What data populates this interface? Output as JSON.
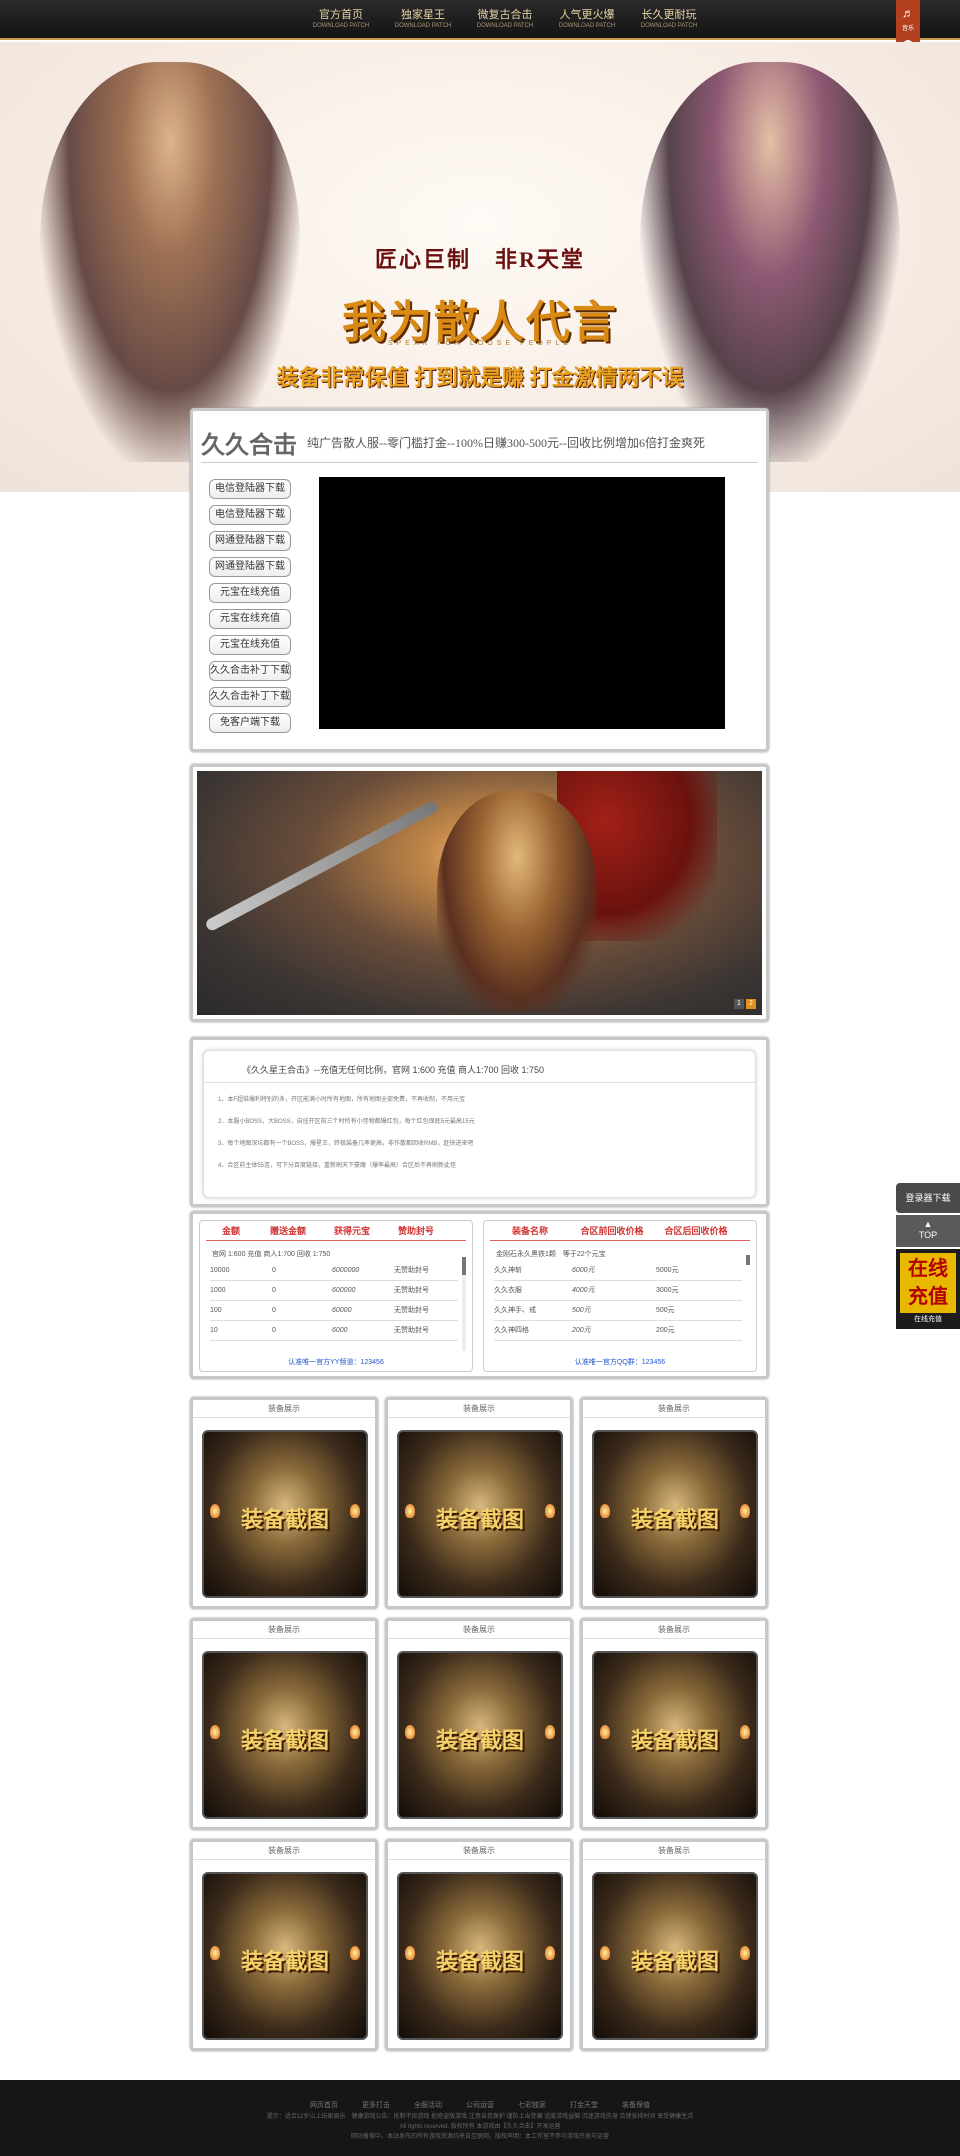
{
  "nav": {
    "items": [
      {
        "title": "官方首页",
        "sub": "DOWNLOAD PATCH"
      },
      {
        "title": "独家星王",
        "sub": "DOWNLOAD PATCH"
      },
      {
        "title": "微复古合击",
        "sub": "DOWNLOAD PATCH"
      },
      {
        "title": "人气更火爆",
        "sub": "DOWNLOAD PATCH"
      },
      {
        "title": "长久更耐玩",
        "sub": "DOWNLOAD PATCH"
      }
    ],
    "music_label": "音乐"
  },
  "hero": {
    "line1": "匠心巨制　非R天堂",
    "line2": "我为散人代言",
    "line2_sub": "SPEAK FOR LOOSE PEOPLE",
    "line3": "装备非常保值 打到就是赚 打金激情两不误"
  },
  "intro": {
    "brand": "久久合击",
    "slogan": "纯广告散人服--零门槛打金--100%日赚300-500元--回收比例增加6倍打金爽死",
    "downloads": [
      "电信登陆器下载",
      "电信登陆器下载",
      "网通登陆器下载",
      "网通登陆器下载",
      "元宝在线充值",
      "元宝在线充值",
      "元宝在线充值",
      "久久合击补丁下载",
      "久久合击补丁下载",
      "免客户端下载"
    ]
  },
  "banner": {
    "pages": [
      "1",
      "2"
    ]
  },
  "notice": {
    "title": "《久久星王合击》--充值无任何比例，官网 1:600 充值 商人1:700 回收 1:750",
    "rules": [
      "1、本F超倍爆利特别的多，开区能满小时所有地图，所有地图全部免费，不再收制，不用元宝",
      "2、本服小BOSS，大BOSS，自挂开区前三个时所有小怪物都爆红包，每个红包保底5元最高15元",
      "3、每个地图深坑都有一个BOSS，爆星王，终极装备几率更高，非作散都回收RMB，赶快进来吧",
      "4、合区前主体55连，可下分百度链接，重新刷天下豪魔（爆率最高）合区后不再刷新此怪"
    ]
  },
  "recharge": {
    "headers": [
      "金额",
      "赠送金额",
      "获得元宝",
      "赞助封号"
    ],
    "note": "官网 1:600 充值 商人1:700 回收 1:750",
    "rows": [
      [
        "10000",
        "0",
        "6000000",
        "无赞助封号"
      ],
      [
        "1000",
        "0",
        "600000",
        "无赞助封号"
      ],
      [
        "100",
        "0",
        "60000",
        "无赞助封号"
      ],
      [
        "10",
        "0",
        "6000",
        "无赞助封号"
      ]
    ],
    "footer": "认准唯一官方YY频道：123456"
  },
  "recycle": {
    "headers": [
      "装备名称",
      "合区前回收价格",
      "合区后回收价格"
    ],
    "note": "金刚石永久黑铁1颗　等于22个元宝",
    "rows": [
      [
        "久久神斩",
        "6000元",
        "5000元"
      ],
      [
        "久久衣服",
        "4000元",
        "3000元"
      ],
      [
        "久久神手、戒",
        "500元",
        "500元"
      ],
      [
        "久久神四格",
        "200元",
        "200元"
      ]
    ],
    "footer": "认准唯一官方QQ群：123456"
  },
  "equip": {
    "title": "装备展示",
    "image_label": "装备截图"
  },
  "side": {
    "launcher": "登录器下载",
    "top": "TOP",
    "recharge_big": "在线充值",
    "recharge_small": "在线充值"
  },
  "footer": {
    "links": [
      "网页首页",
      "更多打击",
      "全服活动",
      "公司运营",
      "七彩独家",
      "打金天堂",
      "装备保值"
    ],
    "line1": "提示：适合12岁以上玩家娱乐　健康游戏公告：抵制不良游戏 拒绝盗版游戏 注意自我保护 谨防上当受骗 适度游戏益脑 沉迷游戏伤身 合理安排时间 享受健康生活",
    "line2": "All rights reserved. 版权所有 本游戏由【久久合击】开发运营",
    "line3": "网站备案中，本站发布的所有游戏资源均来自互联网，版权声明：本工作室不参与游戏开发与运营"
  }
}
